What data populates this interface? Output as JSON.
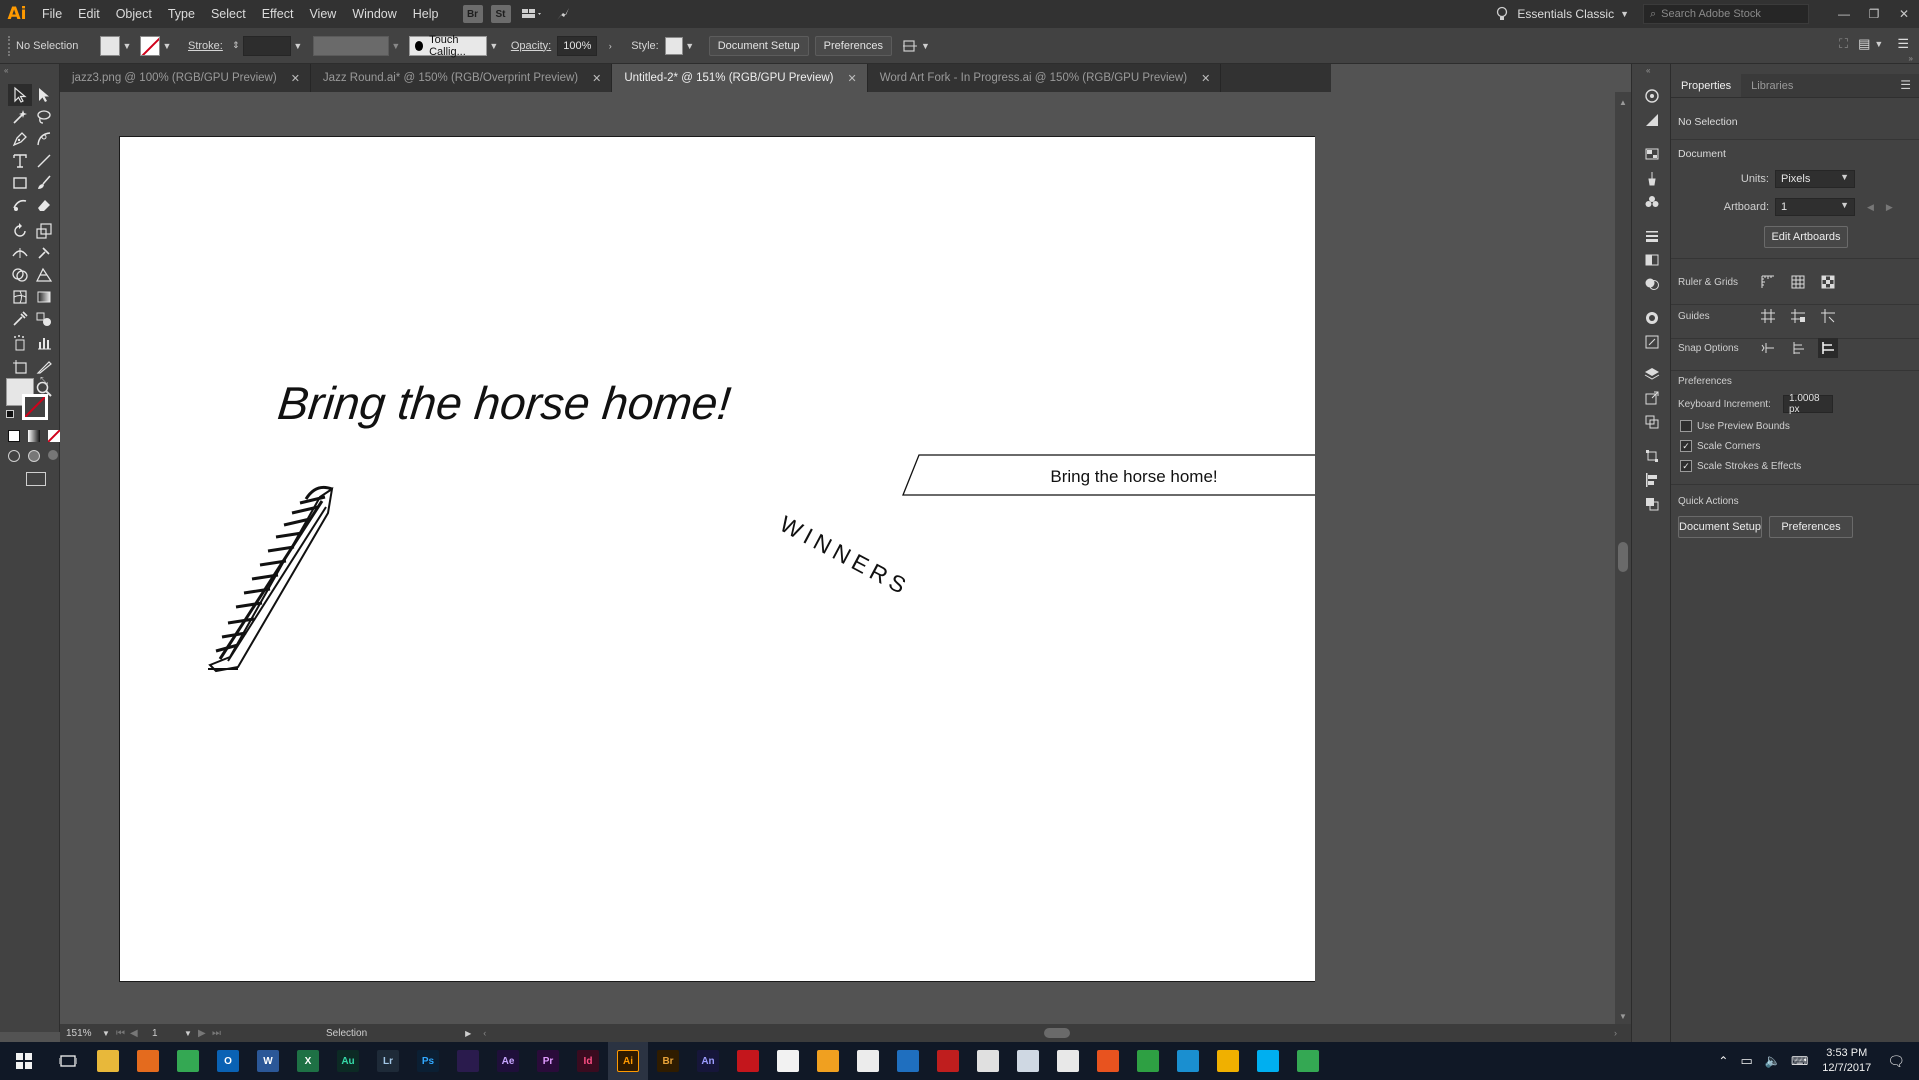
{
  "app": {
    "logo": "Ai",
    "menus": [
      "File",
      "Edit",
      "Object",
      "Type",
      "Select",
      "Effect",
      "View",
      "Window",
      "Help"
    ],
    "bridge_badge": "Br",
    "stock_badge": "St",
    "workspace": "Essentials Classic",
    "search_placeholder": "Search Adobe Stock"
  },
  "control_bar": {
    "selection": "No Selection",
    "stroke_label": "Stroke:",
    "brush": "Touch Callig...",
    "opacity_label": "Opacity:",
    "opacity_value": "100%",
    "style_label": "Style:",
    "document_setup": "Document Setup",
    "preferences": "Preferences"
  },
  "tabs": [
    {
      "label": "jazz3.png @ 100% (RGB/GPU Preview)",
      "active": false
    },
    {
      "label": "Jazz Round.ai* @ 150% (RGB/Overprint Preview)",
      "active": false
    },
    {
      "label": "Untitled-2* @ 151% (RGB/GPU Preview)",
      "active": true
    },
    {
      "label": "Word Art Fork - In Progress.ai @ 150% (RGB/GPU Preview)",
      "active": false
    }
  ],
  "artwork": {
    "heading": "Bring the horse home!",
    "banner_text": "Bring the horse home!",
    "arc_text": "WINNERS"
  },
  "status_bar": {
    "zoom": "151%",
    "artboard_nav": "1",
    "tool": "Selection"
  },
  "properties": {
    "tabs": [
      "Properties",
      "Libraries"
    ],
    "selection": "No Selection",
    "document_title": "Document",
    "units_label": "Units:",
    "units_value": "Pixels",
    "artboard_label": "Artboard:",
    "artboard_value": "1",
    "edit_artboards": "Edit Artboards",
    "ruler_grids": "Ruler & Grids",
    "guides": "Guides",
    "snap_options": "Snap Options",
    "preferences_title": "Preferences",
    "keyboard_increment_label": "Keyboard Increment:",
    "keyboard_increment_value": "1.0008 px",
    "use_preview_bounds": "Use Preview Bounds",
    "scale_corners": "Scale Corners",
    "scale_strokes": "Scale Strokes & Effects",
    "quick_actions": "Quick Actions",
    "qa_document_setup": "Document Setup",
    "qa_preferences": "Preferences"
  },
  "taskbar": {
    "apps": [
      {
        "name": "file-explorer",
        "label": "",
        "bg": "#e8b83a",
        "fg": "#6a4a00"
      },
      {
        "name": "firefox",
        "label": "",
        "bg": "#e46b1e",
        "fg": "#ffffff"
      },
      {
        "name": "chrome",
        "label": "",
        "bg": "#34a853",
        "fg": "#ffffff"
      },
      {
        "name": "outlook",
        "label": "O",
        "bg": "#0a62b4",
        "fg": "#ffffff"
      },
      {
        "name": "word",
        "label": "W",
        "bg": "#2b5797",
        "fg": "#ffffff"
      },
      {
        "name": "excel",
        "label": "X",
        "bg": "#1e7145",
        "fg": "#ffffff"
      },
      {
        "name": "audition",
        "label": "Au",
        "bg": "#0c2a24",
        "fg": "#36d9a8"
      },
      {
        "name": "lightroom",
        "label": "Lr",
        "bg": "#1e2a38",
        "fg": "#a3c6e6"
      },
      {
        "name": "photoshop",
        "label": "Ps",
        "bg": "#0b1f33",
        "fg": "#31a8ff"
      },
      {
        "name": "media-encoder",
        "label": "",
        "bg": "#2a1b4d",
        "fg": "#b39bf0"
      },
      {
        "name": "after-effects",
        "label": "Ae",
        "bg": "#1f0f3a",
        "fg": "#c8a7ff"
      },
      {
        "name": "premiere",
        "label": "Pr",
        "bg": "#2a0b3a",
        "fg": "#e09bff"
      },
      {
        "name": "indesign",
        "label": "Id",
        "bg": "#3a0b1f",
        "fg": "#ff4f85"
      },
      {
        "name": "illustrator",
        "label": "Ai",
        "bg": "#2f1a00",
        "fg": "#ff9a00"
      },
      {
        "name": "bridge",
        "label": "Br",
        "bg": "#2f1c00",
        "fg": "#e8a33a"
      },
      {
        "name": "animate",
        "label": "An",
        "bg": "#16163a",
        "fg": "#9d9dff"
      },
      {
        "name": "acrobat",
        "label": "",
        "bg": "#c4161c",
        "fg": "#ffffff"
      },
      {
        "name": "itunes",
        "label": "",
        "bg": "#f2f2f2",
        "fg": "#d03a9a"
      },
      {
        "name": "fl-studio",
        "label": "",
        "bg": "#f0a020",
        "fg": "#202020"
      },
      {
        "name": "media-app",
        "label": "",
        "bg": "#ececec",
        "fg": "#c01010"
      },
      {
        "name": "notepad",
        "label": "",
        "bg": "#1f6fbf",
        "fg": "#ffffff"
      },
      {
        "name": "filezilla",
        "label": "",
        "bg": "#bf1e1e",
        "fg": "#ffffff"
      },
      {
        "name": "calculator",
        "label": "",
        "bg": "#e0e0e0",
        "fg": "#333333"
      },
      {
        "name": "scanner",
        "label": "",
        "bg": "#cfd8e3",
        "fg": "#333333"
      },
      {
        "name": "cloud-app",
        "label": "",
        "bg": "#e8e8e8",
        "fg": "#c01a1a"
      },
      {
        "name": "stocks-app",
        "label": "",
        "bg": "#e8531f",
        "fg": "#ffffff"
      },
      {
        "name": "search-app",
        "label": "",
        "bg": "#2ea043",
        "fg": "#ffffff"
      },
      {
        "name": "tools-app",
        "label": "",
        "bg": "#1a8fd0",
        "fg": "#ffffff"
      },
      {
        "name": "sticky-app",
        "label": "",
        "bg": "#f0b000",
        "fg": "#ffffff"
      },
      {
        "name": "skype",
        "label": "",
        "bg": "#00aff0",
        "fg": "#ffffff"
      },
      {
        "name": "chrome-2",
        "label": "",
        "bg": "#34a853",
        "fg": "#ffffff"
      }
    ],
    "time": "3:53 PM",
    "date": "12/7/2017"
  },
  "colors": {
    "ai_orange": "#ff9a00",
    "ui_dark": "#323232",
    "ui_mid": "#424242",
    "canvas_bg": "#535353"
  }
}
